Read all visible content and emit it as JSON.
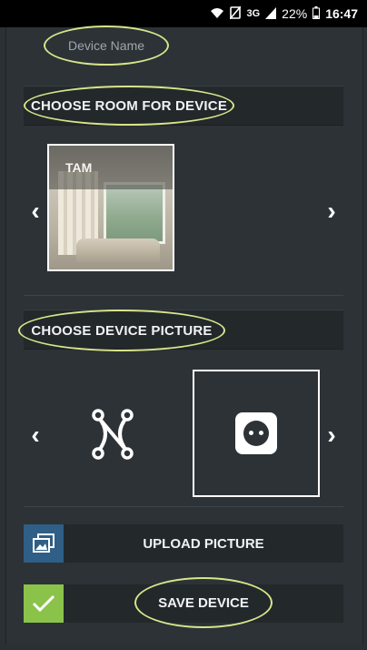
{
  "status_bar": {
    "battery": "22%",
    "time": "16:47",
    "network": "3G",
    "icons": [
      "wifi-icon",
      "no-sim-icon",
      "signal-icon",
      "battery-icon"
    ]
  },
  "form": {
    "device_name_placeholder": "Device Name"
  },
  "room_section": {
    "title": "CHOOSE ROOM FOR DEVICE",
    "rooms": [
      {
        "label": "TAM",
        "selected": true
      }
    ],
    "prev_icon": "chevron-left-icon",
    "next_icon": "chevron-right-icon"
  },
  "picture_section": {
    "title": "CHOOSE DEVICE PICTURE",
    "pictures": [
      {
        "icon": "network-nodes-icon",
        "selected": false
      },
      {
        "icon": "power-socket-icon",
        "selected": true
      }
    ],
    "prev_icon": "chevron-left-icon",
    "next_icon": "chevron-right-icon"
  },
  "actions": {
    "upload_label": "UPLOAD PICTURE",
    "save_label": "SAVE DEVICE",
    "upload_icon": "image-upload-icon",
    "save_icon": "checkmark-icon"
  },
  "colors": {
    "background": "#2c3236",
    "bar": "#23282b",
    "highlight": "#d7e58a",
    "upload_accent": "#2f5e86",
    "save_accent": "#8bc34a"
  }
}
